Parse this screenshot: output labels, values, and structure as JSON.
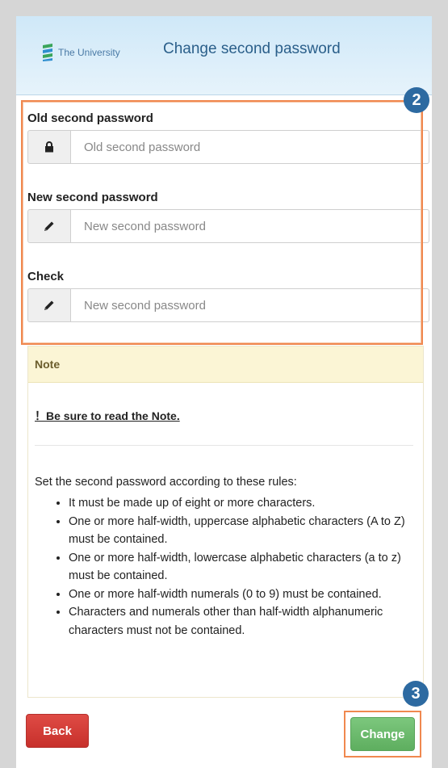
{
  "header": {
    "logo_text": "The University",
    "title": "Change second password"
  },
  "form": {
    "old": {
      "label": "Old second password",
      "placeholder": "Old second password",
      "icon": "lock-icon"
    },
    "new": {
      "label": "New second password",
      "placeholder": "New second password",
      "icon": "pencil-icon"
    },
    "check": {
      "label": "Check",
      "placeholder": "New second password",
      "icon": "pencil-icon"
    }
  },
  "markers": {
    "form": "2",
    "change": "3"
  },
  "note": {
    "title": "Note",
    "warning": "！Be sure to read the Note.",
    "intro": "Set the second password according to these rules:",
    "rules": [
      "It must be made up of eight or more characters.",
      "One or more half-width, uppercase alphabetic characters (A to Z) must be contained.",
      "One or more half-width, lowercase alphabetic characters (a to z) must be contained.",
      "One or more half-width numerals (0 to 9) must be contained.",
      "Characters and numerals other than half-width alphanumeric characters must not be contained."
    ]
  },
  "buttons": {
    "back": "Back",
    "change": "Change"
  },
  "colors": {
    "highlight": "#f0884f",
    "marker": "#2d6aa1",
    "back": "#d43f3a",
    "change": "#6bba6c"
  }
}
